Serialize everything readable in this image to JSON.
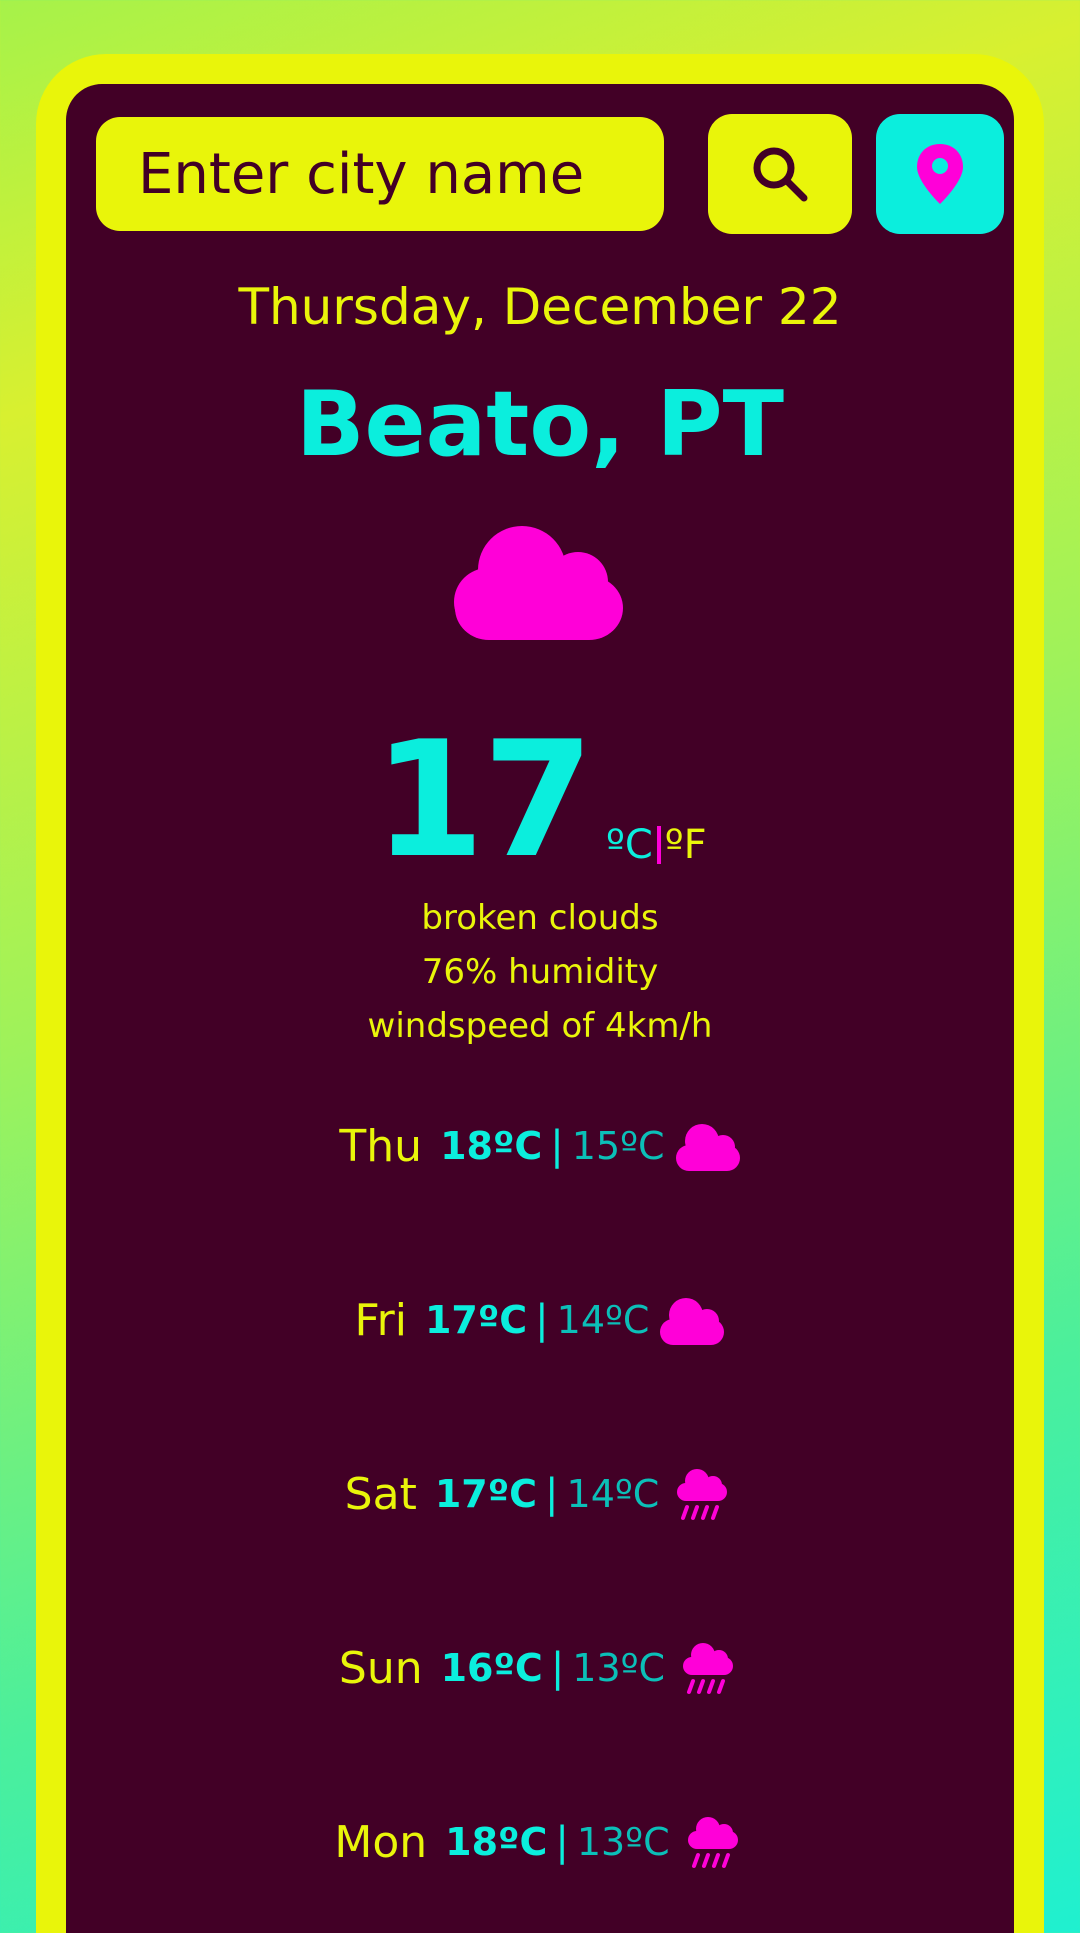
{
  "search": {
    "placeholder": "Enter city name"
  },
  "header": {
    "date": "Thursday, December 22",
    "city": "Beato, PT"
  },
  "current": {
    "icon": "cloud-icon",
    "temperature": "17",
    "unit_c": "ºC",
    "unit_f": "ºF",
    "description": "broken clouds",
    "humidity": "76% humidity",
    "wind": "windspeed of 4km/h"
  },
  "forecast": [
    {
      "day": "Thu",
      "max": "18ºC",
      "sep": "|",
      "min": "15ºC",
      "icon": "cloud-icon"
    },
    {
      "day": "Fri",
      "max": "17ºC",
      "sep": "|",
      "min": "14ºC",
      "icon": "cloud-icon"
    },
    {
      "day": "Sat",
      "max": "17ºC",
      "sep": "|",
      "min": "14ºC",
      "icon": "rain-icon"
    },
    {
      "day": "Sun",
      "max": "16ºC",
      "sep": "|",
      "min": "13ºC",
      "icon": "rain-icon"
    },
    {
      "day": "Mon",
      "max": "18ºC",
      "sep": "|",
      "min": "13ºC",
      "icon": "rain-icon"
    }
  ],
  "colors": {
    "background_card": "#420026",
    "accent_yellow": "#e9f50a",
    "accent_cyan": "#0beedd",
    "accent_magenta": "#ff00d8"
  }
}
